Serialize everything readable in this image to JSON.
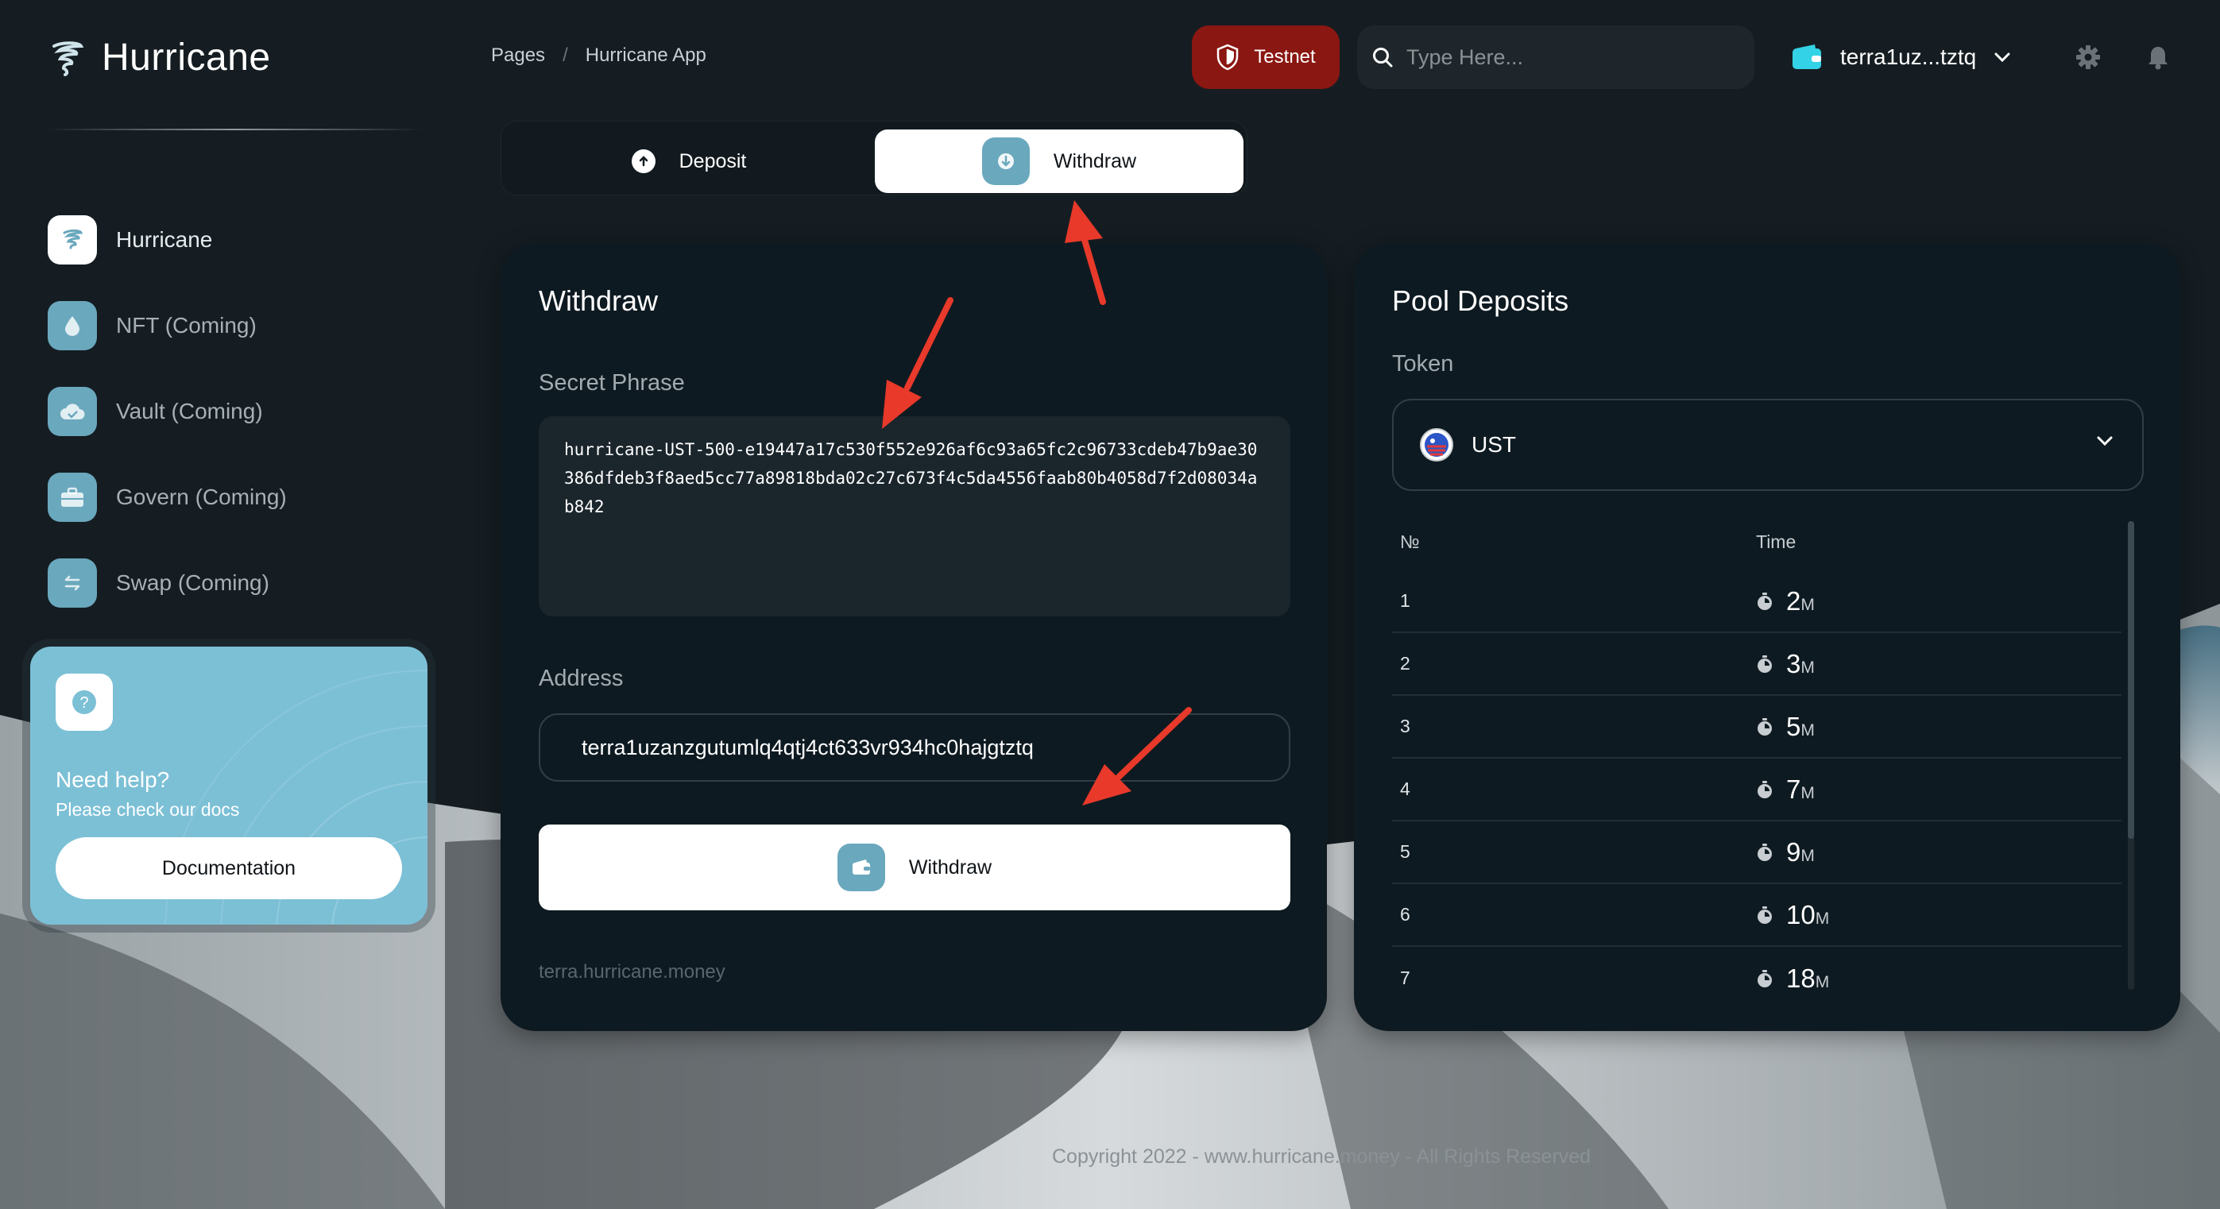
{
  "app": {
    "brand_title": "Hurricane"
  },
  "sidebar": {
    "items": [
      {
        "label": "Hurricane",
        "icon": "hurricane-icon",
        "active": true
      },
      {
        "label": "NFT (Coming)",
        "icon": "drop-icon"
      },
      {
        "label": "Vault (Coming)",
        "icon": "cloud-icon"
      },
      {
        "label": "Govern (Coming)",
        "icon": "briefcase-icon"
      },
      {
        "label": "Swap (Coming)",
        "icon": "swap-icon"
      }
    ],
    "help": {
      "title": "Need help?",
      "subtitle": "Please check our docs",
      "button_label": "Documentation"
    }
  },
  "header": {
    "breadcrumb": [
      "Pages",
      "Hurricane App"
    ],
    "breadcrumb_separator": "/",
    "network_label": "Testnet",
    "search_placeholder": "Type Here...",
    "wallet_label": "terra1uz...tztq"
  },
  "tabs": {
    "deposit_label": "Deposit",
    "withdraw_label": "Withdraw",
    "active": "withdraw"
  },
  "withdraw": {
    "title": "Withdraw",
    "secret_label": "Secret Phrase",
    "secret_value": "hurricane-UST-500-e19447a17c530f552e926af6c93a65fc2c96733cdeb47b9ae30386dfdeb3f8aed5cc77a89818bda02c27c673f4c5da4556faab80b4058d7f2d08034ab842",
    "address_label": "Address",
    "address_value": "terra1uzanzgutumlq4qtj4ct633vr934hc0hajgtztq",
    "button_label": "Withdraw",
    "footer_link": "terra.hurricane.money"
  },
  "pool": {
    "title": "Pool Deposits",
    "token_label": "Token",
    "token_value": "UST",
    "columns": [
      "№",
      "Time"
    ],
    "rows": [
      {
        "num": "1",
        "time": "2",
        "unit": "M"
      },
      {
        "num": "2",
        "time": "3",
        "unit": "M"
      },
      {
        "num": "3",
        "time": "5",
        "unit": "M"
      },
      {
        "num": "4",
        "time": "7",
        "unit": "M"
      },
      {
        "num": "5",
        "time": "9",
        "unit": "M"
      },
      {
        "num": "6",
        "time": "10",
        "unit": "M"
      },
      {
        "num": "7",
        "time": "18",
        "unit": "M"
      }
    ]
  },
  "footer": {
    "copyright": "Copyright 2022 - www.hurricane.money - All Rights Reserved"
  },
  "colors": {
    "accent_teal": "#6aa8bd",
    "help_card": "#7cc0d6",
    "testnet_red": "#8a1712",
    "card_bg": "#0e1a21",
    "arrow_red": "#e8392a"
  }
}
